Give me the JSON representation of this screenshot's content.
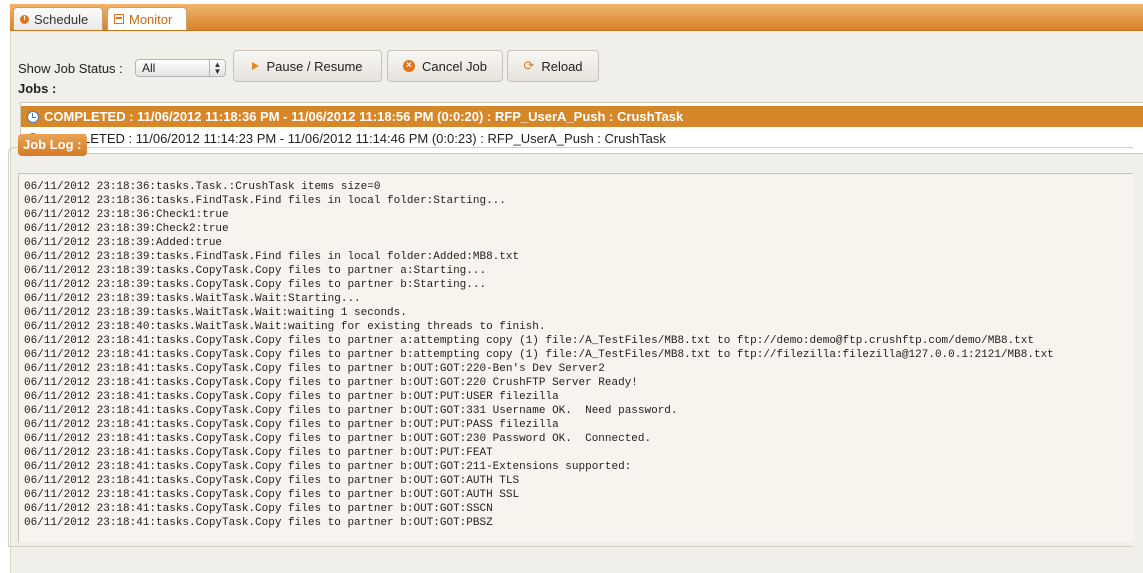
{
  "tabs": [
    {
      "label": "Schedule",
      "icon": "clock-icon"
    },
    {
      "label": "Monitor",
      "icon": "monitor-icon",
      "active": true
    }
  ],
  "toolbar": {
    "status_label": "Show Job Status :",
    "status_value": "All",
    "pause_label": "Pause / Resume",
    "cancel_label": "Cancel Job",
    "reload_label": "Reload"
  },
  "jobs": {
    "label": "Jobs :",
    "items": [
      {
        "text": "COMPLETED : 11/06/2012 11:18:36 PM - 11/06/2012 11:18:56 PM (0:0:20) : RFP_UserA_Push : CrushTask",
        "selected": true
      },
      {
        "text": "COMPLETED : 11/06/2012 11:14:23 PM - 11/06/2012 11:14:46 PM (0:0:23) : RFP_UserA_Push : CrushTask",
        "selected": false
      }
    ]
  },
  "log": {
    "title": "Job Log :",
    "lines": [
      "06/11/2012 23:18:36:tasks.Task.:CrushTask items size=0",
      "06/11/2012 23:18:36:tasks.FindTask.Find files in local folder:Starting...",
      "06/11/2012 23:18:36:Check1:true",
      "06/11/2012 23:18:39:Check2:true",
      "06/11/2012 23:18:39:Added:true",
      "06/11/2012 23:18:39:tasks.FindTask.Find files in local folder:Added:MB8.txt",
      "06/11/2012 23:18:39:tasks.CopyTask.Copy files to partner a:Starting...",
      "06/11/2012 23:18:39:tasks.CopyTask.Copy files to partner b:Starting...",
      "06/11/2012 23:18:39:tasks.WaitTask.Wait:Starting...",
      "06/11/2012 23:18:39:tasks.WaitTask.Wait:waiting 1 seconds.",
      "06/11/2012 23:18:40:tasks.WaitTask.Wait:waiting for existing threads to finish.",
      "06/11/2012 23:18:41:tasks.CopyTask.Copy files to partner a:attempting copy (1) file:/A_TestFiles/MB8.txt to ftp://demo:demo@ftp.crushftp.com/demo/MB8.txt",
      "06/11/2012 23:18:41:tasks.CopyTask.Copy files to partner b:attempting copy (1) file:/A_TestFiles/MB8.txt to ftp://filezilla:filezilla@127.0.0.1:2121/MB8.txt",
      "06/11/2012 23:18:41:tasks.CopyTask.Copy files to partner b:OUT:GOT:220-Ben's Dev Server2",
      "06/11/2012 23:18:41:tasks.CopyTask.Copy files to partner b:OUT:GOT:220 CrushFTP Server Ready!",
      "06/11/2012 23:18:41:tasks.CopyTask.Copy files to partner b:OUT:PUT:USER filezilla",
      "06/11/2012 23:18:41:tasks.CopyTask.Copy files to partner b:OUT:GOT:331 Username OK.  Need password.",
      "06/11/2012 23:18:41:tasks.CopyTask.Copy files to partner b:OUT:PUT:PASS filezilla",
      "06/11/2012 23:18:41:tasks.CopyTask.Copy files to partner b:OUT:GOT:230 Password OK.  Connected.",
      "06/11/2012 23:18:41:tasks.CopyTask.Copy files to partner b:OUT:PUT:FEAT",
      "06/11/2012 23:18:41:tasks.CopyTask.Copy files to partner b:OUT:GOT:211-Extensions supported:",
      "06/11/2012 23:18:41:tasks.CopyTask.Copy files to partner b:OUT:GOT:AUTH TLS",
      "06/11/2012 23:18:41:tasks.CopyTask.Copy files to partner b:OUT:GOT:AUTH SSL",
      "06/11/2012 23:18:41:tasks.CopyTask.Copy files to partner b:OUT:GOT:SSCN",
      "06/11/2012 23:18:41:tasks.CopyTask.Copy files to partner b:OUT:GOT:PBSZ"
    ]
  }
}
